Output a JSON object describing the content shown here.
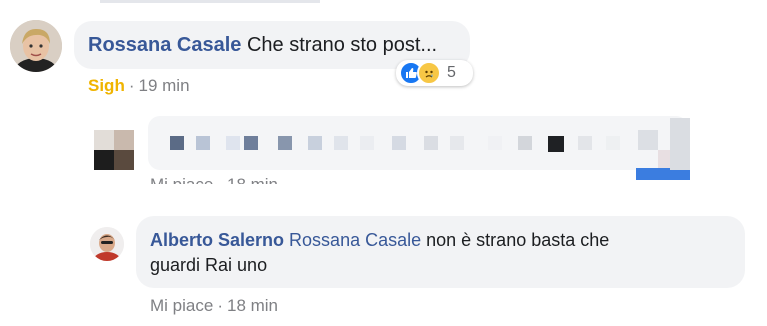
{
  "comments": [
    {
      "author": "Rossana Casale",
      "text": "Che strano sto post...",
      "reaction_label": "Sigh",
      "time": "19 min",
      "reaction_count": "5",
      "reaction_icons": [
        "like-icon",
        "sad-icon"
      ]
    },
    {
      "blurred": true,
      "like_label": "Mi piace",
      "time": "18 min"
    },
    {
      "author": "Alberto Salerno",
      "mention": "Rossana Casale",
      "text_line1": "non è strano basta che",
      "text_line2": "guardi Rai uno",
      "like_label": "Mi piace",
      "time": "18 min"
    }
  ],
  "colors": {
    "name": "#385898",
    "sigh": "#f0b400",
    "bubble": "#f2f3f5",
    "meta": "#7f8084"
  }
}
